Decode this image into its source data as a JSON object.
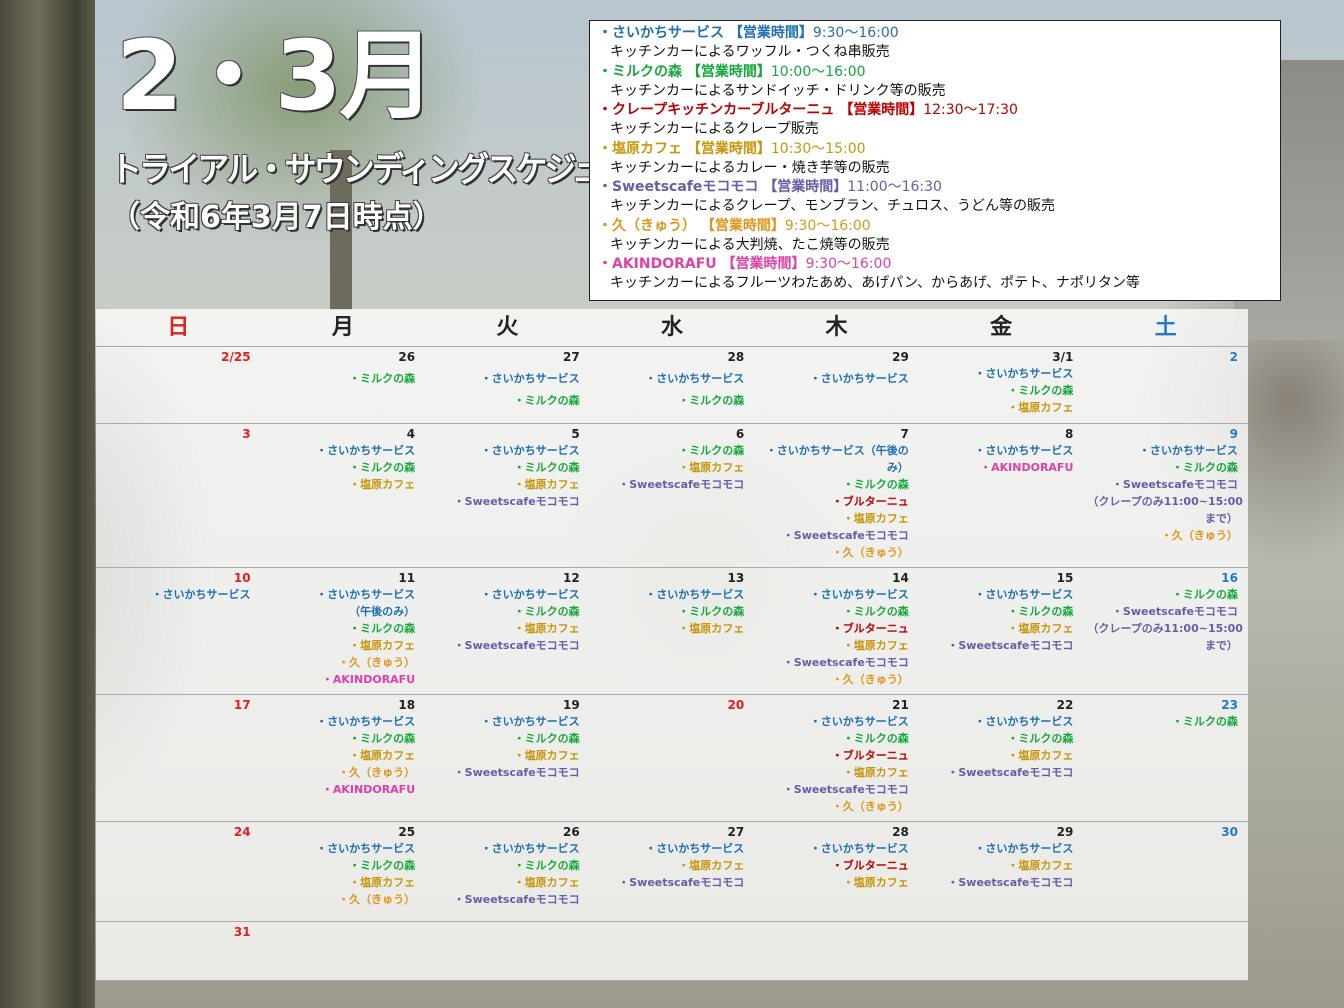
{
  "title": {
    "months": "2・3月",
    "subtitle": "トライアル・サウンディングスケジュール",
    "as_of": "（令和6年3月7日時点）"
  },
  "colors": {
    "sai": "#1f6fb5",
    "mori": "#14a83c",
    "crepe": "#c00000",
    "shio": "#c8960c",
    "sweets": "#6a5ca8",
    "kyu": "#e0961c",
    "akin": "#e040a8",
    "sun": "#e02020",
    "sat": "#1f7ad0",
    "day": "#222222"
  },
  "legend": [
    {
      "c": "sai",
      "name": "・さいかちサービス",
      "hours_label": "【営業時間】",
      "hours": "9:30〜16:00",
      "desc": "キッチンカーによるワッフル・つくね串販売"
    },
    {
      "c": "mori",
      "name": "・ミルクの森",
      "hours_label": "【営業時間】",
      "hours": "10:00〜16:00",
      "desc": "キッチンカーによるサンドイッチ・ドリンク等の販売"
    },
    {
      "c": "crepe",
      "name": "・クレープキッチンカーブルターニュ",
      "hours_label": "【営業時間】",
      "hours": "12:30〜17:30",
      "desc": "キッチンカーによるクレープ販売"
    },
    {
      "c": "shio",
      "name": "・塩原カフェ",
      "hours_label": "【営業時間】",
      "hours": "10:30〜15:00",
      "desc": "キッチンカーによるカレー・焼き芋等の販売"
    },
    {
      "c": "sweets",
      "name": "・Sweetscafeモコモコ",
      "hours_label": "【営業時間】",
      "hours": "11:00〜16:30",
      "desc": "キッチンカーによるクレープ、モンブラン、チュロス、うどん等の販売"
    },
    {
      "c": "kyu",
      "name": "・久（きゅう）",
      "hours_label": "【営業時間】",
      "hours": "9:30〜16:00",
      "desc": "キッチンカーによる大判焼、たこ焼等の販売"
    },
    {
      "c": "akin",
      "name": "・AKINDORAFU",
      "hours_label": "【営業時間】",
      "hours": "9:30〜16:00",
      "desc": "キッチンカーによるフルーツわたあめ、あげパン、からあげ、ポテト、ナポリタン等"
    }
  ],
  "weekdays": [
    "日",
    "月",
    "火",
    "水",
    "木",
    "金",
    "土"
  ],
  "weeks": [
    {
      "days": [
        {
          "d": "2/25",
          "ev": []
        },
        {
          "d": "26",
          "ev": [
            [
              "mori",
              "・ミルクの森"
            ]
          ]
        },
        {
          "d": "27",
          "ev": [
            [
              "sai",
              "・さいかちサービス"
            ],
            [
              "mori",
              "・ミルクの森"
            ]
          ]
        },
        {
          "d": "28",
          "ev": [
            [
              "sai",
              "・さいかちサービス"
            ],
            [
              "mori",
              "・ミルクの森"
            ]
          ]
        },
        {
          "d": "29",
          "ev": [
            [
              "sai",
              "・さいかちサービス"
            ]
          ]
        },
        {
          "d": "3/1",
          "ev": [
            [
              "sai",
              "・さいかちサービス"
            ],
            [
              "mori",
              "・ミルクの森"
            ],
            [
              "shio",
              "・塩原カフェ"
            ]
          ]
        },
        {
          "d": "2",
          "ev": []
        }
      ]
    },
    {
      "days": [
        {
          "d": "3",
          "ev": []
        },
        {
          "d": "4",
          "ev": [
            [
              "sai",
              "・さいかちサービス"
            ],
            [
              "mori",
              "・ミルクの森"
            ],
            [
              "shio",
              "・塩原カフェ"
            ]
          ]
        },
        {
          "d": "5",
          "ev": [
            [
              "sai",
              "・さいかちサービス"
            ],
            [
              "mori",
              "・ミルクの森"
            ],
            [
              "shio",
              "・塩原カフェ"
            ],
            [
              "sweets",
              "・Sweetscafeモコモコ"
            ]
          ]
        },
        {
          "d": "6",
          "ev": [
            [
              "mori",
              "・ミルクの森"
            ],
            [
              "shio",
              "・塩原カフェ"
            ],
            [
              "sweets",
              "・Sweetscafeモコモコ"
            ]
          ]
        },
        {
          "d": "7",
          "ev": [
            [
              "sai",
              "・さいかちサービス（午後の"
            ],
            [
              "sai",
              "み）"
            ],
            [
              "mori",
              "・ミルクの森"
            ],
            [
              "crepe",
              "・ブルターニュ"
            ],
            [
              "shio",
              "・塩原カフェ"
            ],
            [
              "sweets",
              "・Sweetscafeモコモコ"
            ],
            [
              "kyu",
              "・久（きゅう）"
            ]
          ]
        },
        {
          "d": "8",
          "ev": [
            [
              "sai",
              "・さいかちサービス"
            ],
            [
              "akin",
              "・AKINDORAFU"
            ]
          ]
        },
        {
          "d": "9",
          "ev": [
            [
              "sai",
              "・さいかちサービス"
            ],
            [
              "mori",
              "・ミルクの森"
            ],
            [
              "sweets",
              "・Sweetscafeモコモコ"
            ],
            [
              "sweets",
              "（クレープのみ11:00~15:00"
            ],
            [
              "sweets",
              "まで）"
            ],
            [
              "kyu",
              "・久（きゅう）"
            ]
          ]
        }
      ]
    },
    {
      "days": [
        {
          "d": "10",
          "ev": [
            [
              "sai",
              "・さいかちサービス"
            ]
          ]
        },
        {
          "d": "11",
          "ev": [
            [
              "sai",
              "・さいかちサービス"
            ],
            [
              "sai",
              "（午後のみ）"
            ],
            [
              "mori",
              "・ミルクの森"
            ],
            [
              "shio",
              "・塩原カフェ"
            ],
            [
              "kyu",
              "・久（きゅう）"
            ],
            [
              "akin",
              "・AKINDORAFU"
            ]
          ]
        },
        {
          "d": "12",
          "ev": [
            [
              "sai",
              "・さいかちサービス"
            ],
            [
              "mori",
              "・ミルクの森"
            ],
            [
              "shio",
              "・塩原カフェ"
            ],
            [
              "sweets",
              "・Sweetscafeモコモコ"
            ]
          ]
        },
        {
          "d": "13",
          "ev": [
            [
              "sai",
              "・さいかちサービス"
            ],
            [
              "mori",
              "・ミルクの森"
            ],
            [
              "shio",
              "・塩原カフェ"
            ]
          ]
        },
        {
          "d": "14",
          "ev": [
            [
              "sai",
              "・さいかちサービス"
            ],
            [
              "mori",
              "・ミルクの森"
            ],
            [
              "crepe",
              "・ブルターニュ"
            ],
            [
              "shio",
              "・塩原カフェ"
            ],
            [
              "sweets",
              "・Sweetscafeモコモコ"
            ],
            [
              "kyu",
              "・久（きゅう）"
            ]
          ]
        },
        {
          "d": "15",
          "ev": [
            [
              "sai",
              "・さいかちサービス"
            ],
            [
              "mori",
              "・ミルクの森"
            ],
            [
              "shio",
              "・塩原カフェ"
            ],
            [
              "sweets",
              "・Sweetscafeモコモコ"
            ]
          ]
        },
        {
          "d": "16",
          "ev": [
            [
              "mori",
              "・ミルクの森"
            ],
            [
              "sweets",
              "・Sweetscafeモコモコ"
            ],
            [
              "sweets",
              "（クレープのみ11:00~15:00"
            ],
            [
              "sweets",
              "まで）"
            ]
          ]
        }
      ]
    },
    {
      "days": [
        {
          "d": "17",
          "ev": []
        },
        {
          "d": "18",
          "ev": [
            [
              "sai",
              "・さいかちサービス"
            ],
            [
              "mori",
              "・ミルクの森"
            ],
            [
              "shio",
              "・塩原カフェ"
            ],
            [
              "kyu",
              "・久（きゅう）"
            ],
            [
              "akin",
              "・AKINDORAFU"
            ]
          ]
        },
        {
          "d": "19",
          "ev": [
            [
              "sai",
              "・さいかちサービス"
            ],
            [
              "mori",
              "・ミルクの森"
            ],
            [
              "shio",
              "・塩原カフェ"
            ],
            [
              "sweets",
              "・Sweetscafeモコモコ"
            ]
          ]
        },
        {
          "d": "20",
          "red": true,
          "ev": []
        },
        {
          "d": "21",
          "ev": [
            [
              "sai",
              "・さいかちサービス"
            ],
            [
              "mori",
              "・ミルクの森"
            ],
            [
              "crepe",
              "・ブルターニュ"
            ],
            [
              "shio",
              "・塩原カフェ"
            ],
            [
              "sweets",
              "・Sweetscafeモコモコ"
            ],
            [
              "kyu",
              "・久（きゅう）"
            ]
          ]
        },
        {
          "d": "22",
          "ev": [
            [
              "sai",
              "・さいかちサービス"
            ],
            [
              "mori",
              "・ミルクの森"
            ],
            [
              "shio",
              "・塩原カフェ"
            ],
            [
              "sweets",
              "・Sweetscafeモコモコ"
            ]
          ]
        },
        {
          "d": "23",
          "ev": [
            [
              "mori",
              "・ミルクの森"
            ]
          ]
        }
      ]
    },
    {
      "days": [
        {
          "d": "24",
          "ev": []
        },
        {
          "d": "25",
          "ev": [
            [
              "sai",
              "・さいかちサービス"
            ],
            [
              "mori",
              "・ミルクの森"
            ],
            [
              "shio",
              "・塩原カフェ"
            ],
            [
              "kyu",
              "・久（きゅう）"
            ]
          ]
        },
        {
          "d": "26",
          "ev": [
            [
              "sai",
              "・さいかちサービス"
            ],
            [
              "mori",
              "・ミルクの森"
            ],
            [
              "shio",
              "・塩原カフェ"
            ],
            [
              "sweets",
              "・Sweetscafeモコモコ"
            ]
          ]
        },
        {
          "d": "27",
          "ev": [
            [
              "sai",
              "・さいかちサービス"
            ],
            [
              "shio",
              "・塩原カフェ"
            ],
            [
              "sweets",
              "・Sweetscafeモコモコ"
            ]
          ]
        },
        {
          "d": "28",
          "ev": [
            [
              "sai",
              "・さいかちサービス"
            ],
            [
              "crepe",
              "・ブルターニュ"
            ],
            [
              "shio",
              "・塩原カフェ"
            ]
          ]
        },
        {
          "d": "29",
          "ev": [
            [
              "sai",
              "・さいかちサービス"
            ],
            [
              "shio",
              "・塩原カフェ"
            ],
            [
              "sweets",
              "・Sweetscafeモコモコ"
            ]
          ]
        },
        {
          "d": "30",
          "ev": []
        }
      ]
    },
    {
      "days": [
        {
          "d": "31",
          "ev": []
        },
        {
          "d": "",
          "ev": []
        },
        {
          "d": "",
          "ev": []
        },
        {
          "d": "",
          "ev": []
        },
        {
          "d": "",
          "ev": []
        },
        {
          "d": "",
          "ev": []
        },
        {
          "d": "",
          "ev": []
        }
      ]
    }
  ]
}
